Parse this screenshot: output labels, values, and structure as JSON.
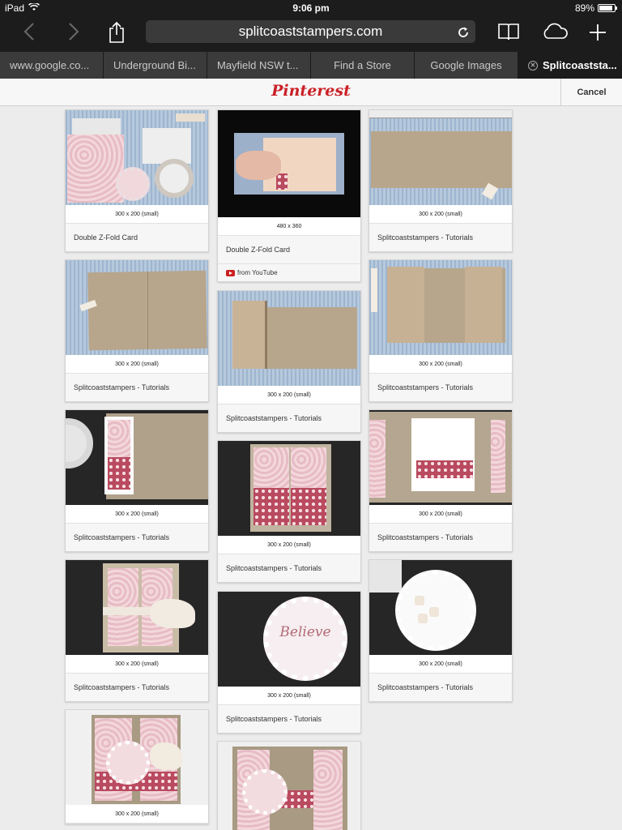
{
  "status": {
    "carrier": "iPad",
    "time": "9:06 pm",
    "battery": "89%",
    "battery_level": 0.89
  },
  "toolbar": {
    "url": "splitcoaststampers.com"
  },
  "tabs": [
    {
      "label": "www.google.co..."
    },
    {
      "label": "Underground Bi..."
    },
    {
      "label": "Mayfield NSW t..."
    },
    {
      "label": "Find a Store"
    },
    {
      "label": "Google Images"
    },
    {
      "label": "Splitcoaststa..."
    }
  ],
  "pin_header": {
    "logo": "Pinterest",
    "cancel": "Cancel"
  },
  "cards": [
    {
      "dims": "300 x 200 (small)",
      "title": "Double Z-Fold Card"
    },
    {
      "dims": "480 x 360",
      "title": "Double Z-Fold Card",
      "source": "from YouTube"
    },
    {
      "dims": "300 x 200 (small)",
      "title": "Splitcoaststampers - Tutorials"
    },
    {
      "dims": "300 x 200 (small)",
      "title": "Splitcoaststampers - Tutorials"
    },
    {
      "dims": "300 x 200 (small)",
      "title": "Splitcoaststampers - Tutorials"
    },
    {
      "dims": "300 x 200 (small)",
      "title": "Splitcoaststampers - Tutorials"
    },
    {
      "dims": "300 x 200 (small)",
      "title": "Splitcoaststampers - Tutorials"
    },
    {
      "dims": "300 x 200 (small)",
      "title": "Splitcoaststampers - Tutorials"
    },
    {
      "dims": "300 x 200 (small)",
      "title": "Splitcoaststampers - Tutorials"
    },
    {
      "dims": "300 x 200 (small)",
      "title": "Splitcoaststampers - Tutorials"
    },
    {
      "dims": "300 x 200 (small)",
      "title": "Splitcoaststampers - Tutorials"
    },
    {
      "dims": "300 x 200 (small)",
      "title": "Splitcoaststampers - Tutorials"
    },
    {
      "dims": "300 x 200 (small)",
      "title": ""
    },
    {
      "dims": "",
      "title": ""
    }
  ]
}
